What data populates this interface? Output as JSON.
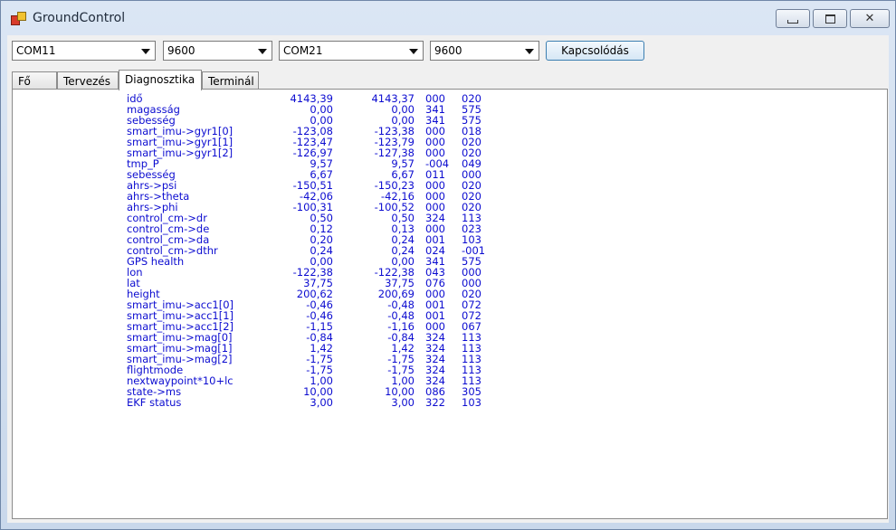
{
  "window": {
    "title": "GroundControl",
    "icon": "app-icon",
    "controls": [
      "minimize-icon",
      "maximize-icon",
      "close-icon"
    ]
  },
  "connection": {
    "port1": "COM11",
    "baud1": "9600",
    "port2": "COM21",
    "baud2": "9600",
    "connect_label": "Kapcsolódás"
  },
  "tabs": [
    {
      "label": "Fő",
      "active": false
    },
    {
      "label": "Tervezés",
      "active": false
    },
    {
      "label": "Diagnosztika",
      "active": true
    },
    {
      "label": "Terminál",
      "active": false
    }
  ],
  "diagnostics": [
    {
      "name": "idő",
      "v1": "4143,39",
      "v2": "4143,37",
      "a": "000",
      "b": "020"
    },
    {
      "name": "magasság",
      "v1": "0,00",
      "v2": "0,00",
      "a": "341",
      "b": "575"
    },
    {
      "name": "sebesség",
      "v1": "0,00",
      "v2": "0,00",
      "a": "341",
      "b": "575"
    },
    {
      "name": "smart_imu->gyr1[0]",
      "v1": "-123,08",
      "v2": "-123,38",
      "a": "000",
      "b": "018"
    },
    {
      "name": "smart_imu->gyr1[1]",
      "v1": "-123,47",
      "v2": "-123,79",
      "a": "000",
      "b": "020"
    },
    {
      "name": "smart_imu->gyr1[2]",
      "v1": "-126,97",
      "v2": "-127,38",
      "a": "000",
      "b": "020"
    },
    {
      "name": "tmp_P",
      "v1": "9,57",
      "v2": "9,57",
      "a": "-004",
      "b": "049"
    },
    {
      "name": "sebesség",
      "v1": "6,67",
      "v2": "6,67",
      "a": "011",
      "b": "000"
    },
    {
      "name": "ahrs->psi",
      "v1": "-150,51",
      "v2": "-150,23",
      "a": "000",
      "b": "020"
    },
    {
      "name": "ahrs->theta",
      "v1": "-42,06",
      "v2": "-42,16",
      "a": "000",
      "b": "020"
    },
    {
      "name": "ahrs->phi",
      "v1": "-100,31",
      "v2": "-100,52",
      "a": "000",
      "b": "020"
    },
    {
      "name": "control_cm->dr",
      "v1": "0,50",
      "v2": "0,50",
      "a": "324",
      "b": "113"
    },
    {
      "name": "control_cm->de",
      "v1": "0,12",
      "v2": "0,13",
      "a": "000",
      "b": "023"
    },
    {
      "name": "control_cm->da",
      "v1": "0,20",
      "v2": "0,24",
      "a": "001",
      "b": "103"
    },
    {
      "name": "control_cm->dthr",
      "v1": "0,24",
      "v2": "0,24",
      "a": "024",
      "b": "-001"
    },
    {
      "name": "GPS health",
      "v1": "0,00",
      "v2": "0,00",
      "a": "341",
      "b": "575"
    },
    {
      "name": "lon",
      "v1": "-122,38",
      "v2": "-122,38",
      "a": "043",
      "b": "000"
    },
    {
      "name": "lat",
      "v1": "37,75",
      "v2": "37,75",
      "a": "076",
      "b": "000"
    },
    {
      "name": "height",
      "v1": "200,62",
      "v2": "200,69",
      "a": "000",
      "b": "020"
    },
    {
      "name": "smart_imu->acc1[0]",
      "v1": "-0,46",
      "v2": "-0,48",
      "a": "001",
      "b": "072"
    },
    {
      "name": "smart_imu->acc1[1]",
      "v1": "-0,46",
      "v2": "-0,48",
      "a": "001",
      "b": "072"
    },
    {
      "name": "smart_imu->acc1[2]",
      "v1": "-1,15",
      "v2": "-1,16",
      "a": "000",
      "b": "067"
    },
    {
      "name": "smart_imu->mag[0]",
      "v1": "-0,84",
      "v2": "-0,84",
      "a": "324",
      "b": "113"
    },
    {
      "name": "smart_imu->mag[1]",
      "v1": "1,42",
      "v2": "1,42",
      "a": "324",
      "b": "113"
    },
    {
      "name": "smart_imu->mag[2]",
      "v1": "-1,75",
      "v2": "-1,75",
      "a": "324",
      "b": "113"
    },
    {
      "name": "flightmode",
      "v1": "-1,75",
      "v2": "-1,75",
      "a": "324",
      "b": "113"
    },
    {
      "name": "nextwaypoint*10+lc",
      "v1": "1,00",
      "v2": "1,00",
      "a": "324",
      "b": "113"
    },
    {
      "name": "state->ms",
      "v1": "10,00",
      "v2": "10,00",
      "a": "086",
      "b": "305"
    },
    {
      "name": "EKF status",
      "v1": "3,00",
      "v2": "3,00",
      "a": "322",
      "b": "103"
    }
  ],
  "colors": {
    "data_text": "#0c0cd0",
    "client_bg": "#f0f0f0",
    "frame": "#c9d8eb"
  }
}
